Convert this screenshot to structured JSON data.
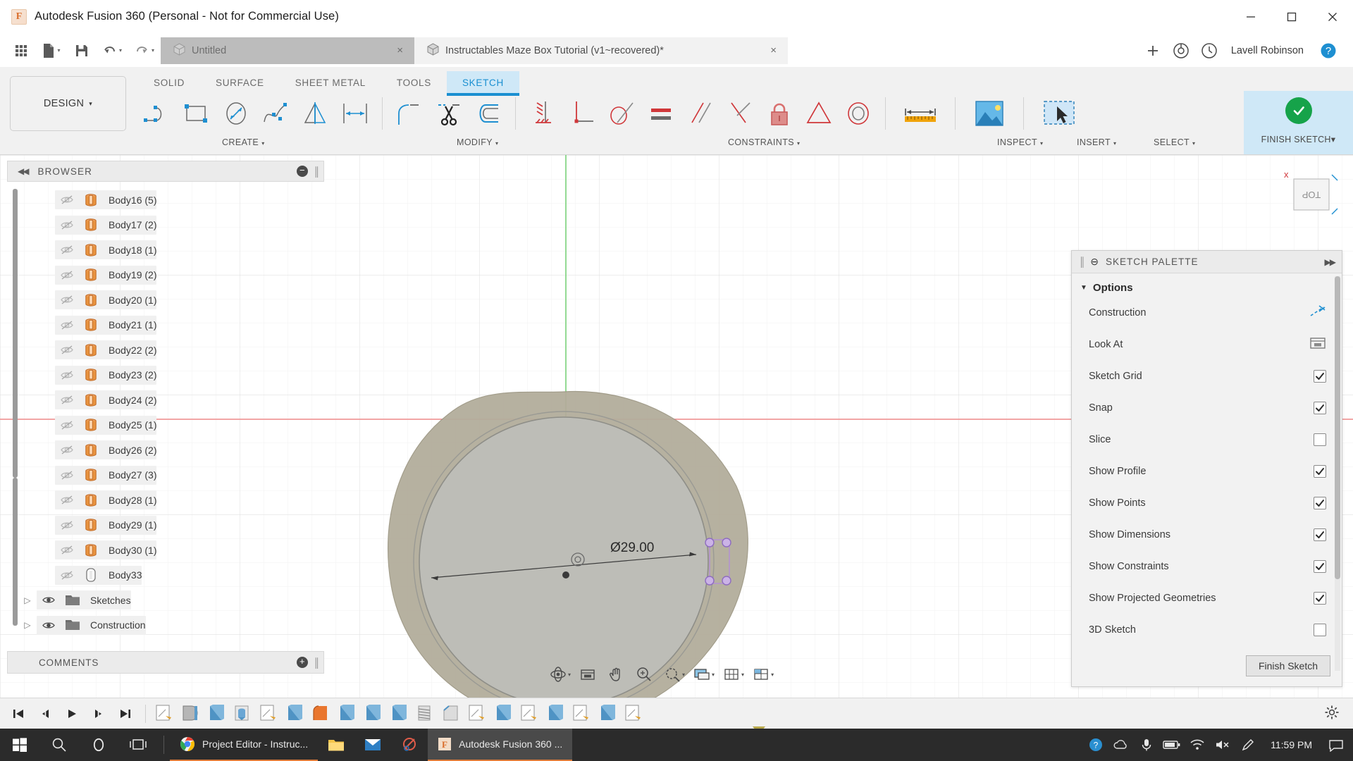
{
  "window": {
    "title": "Autodesk Fusion 360 (Personal - Not for Commercial Use)",
    "logo_letter": "F",
    "minimize": "minimize-icon",
    "maximize": "maximize-icon",
    "close": "close-icon"
  },
  "quickaccess": {
    "grid_label": "show-data-panel-icon",
    "new_label": "new-file-icon",
    "save_label": "save-icon",
    "undo_label": "undo-icon",
    "redo_label": "redo-icon",
    "user_name": "Lavell Robinson",
    "help_label": "help-icon",
    "job_label": "job-status-icon",
    "extensions_label": "extensions-icon",
    "add_tab_label": "+"
  },
  "tabs": [
    {
      "label": "Untitled",
      "active": false,
      "close": "×"
    },
    {
      "label": "Instructables Maze Box Tutorial (v1~recovered)*",
      "active": true,
      "close": "×"
    }
  ],
  "ribbon": {
    "design_label": "DESIGN",
    "design_caret": "▾",
    "workspace_tabs": [
      {
        "label": "SOLID",
        "active": false
      },
      {
        "label": "SURFACE",
        "active": false
      },
      {
        "label": "SHEET METAL",
        "active": false
      },
      {
        "label": "TOOLS",
        "active": false
      },
      {
        "label": "SKETCH",
        "active": true
      }
    ],
    "groups": [
      {
        "label": "CREATE",
        "caret": "▾"
      },
      {
        "label": "MODIFY",
        "caret": "▾"
      },
      {
        "label": "CONSTRAINTS",
        "caret": "▾"
      },
      {
        "label": "INSPECT",
        "caret": "▾"
      },
      {
        "label": "INSERT",
        "caret": "▾"
      },
      {
        "label": "SELECT",
        "caret": "▾"
      },
      {
        "label": "FINISH SKETCH",
        "caret": "▾"
      }
    ],
    "create_tools": [
      "line-icon",
      "rectangle-icon",
      "circle-icon",
      "spline-icon",
      "mirror-icon",
      "rectangular-pattern-icon"
    ],
    "modify_tools": [
      "fillet-icon",
      "trim-icon",
      "offset-icon"
    ],
    "constraint_tools": [
      "coincident-icon",
      "perpendicular-icon",
      "tangent-icon",
      "equal-icon",
      "parallel-icon",
      "midpoint-icon",
      "fix-lock-icon",
      "symmetry-icon",
      "concentric-icon"
    ],
    "inspect_tool": "measure-ruler-icon",
    "insert_tool": "insert-image-icon",
    "select_tool": "select-cursor-icon",
    "finish_tool": "finish-sketch-check-icon"
  },
  "browser": {
    "title": "BROWSER",
    "collapse_icon": "collapse-left-icon",
    "minus_icon": "−",
    "grip_icon": "panel-grip-icon",
    "comments_title": "COMMENTS",
    "comments_plus": "+",
    "items": [
      {
        "label": "Body16 (5)",
        "icon": "body-icon",
        "eye": "hidden-eye-icon",
        "twist": ""
      },
      {
        "label": "Body17 (2)",
        "icon": "body-icon",
        "eye": "hidden-eye-icon",
        "twist": ""
      },
      {
        "label": "Body18 (1)",
        "icon": "body-icon",
        "eye": "hidden-eye-icon",
        "twist": ""
      },
      {
        "label": "Body19 (2)",
        "icon": "body-icon",
        "eye": "hidden-eye-icon",
        "twist": ""
      },
      {
        "label": "Body20 (1)",
        "icon": "body-icon",
        "eye": "hidden-eye-icon",
        "twist": ""
      },
      {
        "label": "Body21 (1)",
        "icon": "body-icon",
        "eye": "hidden-eye-icon",
        "twist": ""
      },
      {
        "label": "Body22 (2)",
        "icon": "body-icon",
        "eye": "hidden-eye-icon",
        "twist": ""
      },
      {
        "label": "Body23 (2)",
        "icon": "body-icon",
        "eye": "hidden-eye-icon",
        "twist": ""
      },
      {
        "label": "Body24 (2)",
        "icon": "body-icon",
        "eye": "hidden-eye-icon",
        "twist": ""
      },
      {
        "label": "Body25 (1)",
        "icon": "body-icon",
        "eye": "hidden-eye-icon",
        "twist": ""
      },
      {
        "label": "Body26 (2)",
        "icon": "body-icon",
        "eye": "hidden-eye-icon",
        "twist": ""
      },
      {
        "label": "Body27 (3)",
        "icon": "body-icon",
        "eye": "hidden-eye-icon",
        "twist": ""
      },
      {
        "label": "Body28 (1)",
        "icon": "body-icon",
        "eye": "hidden-eye-icon",
        "twist": ""
      },
      {
        "label": "Body29 (1)",
        "icon": "body-icon",
        "eye": "hidden-eye-icon",
        "twist": ""
      },
      {
        "label": "Body30 (1)",
        "icon": "body-icon",
        "eye": "hidden-eye-icon",
        "twist": ""
      },
      {
        "label": "Body33",
        "icon": "sketch-body-icon",
        "eye": "hidden-eye-icon",
        "twist": ""
      },
      {
        "label": "Sketches",
        "icon": "folder-icon",
        "eye": "visible-eye-icon",
        "twist": "▷"
      },
      {
        "label": "Construction",
        "icon": "folder-icon",
        "eye": "visible-eye-icon",
        "twist": "▷"
      }
    ]
  },
  "palette": {
    "title": "SKETCH PALETTE",
    "minus_icon": "⊖",
    "expand_icon": "▶▶",
    "grip_icon": "panel-grip-icon",
    "section_title": "Options",
    "section_caret": "▼",
    "finish_button": "Finish Sketch",
    "rows": [
      {
        "label": "Construction",
        "control": "icon",
        "icon": "construction-line-icon",
        "checked": null
      },
      {
        "label": "Look At",
        "control": "icon",
        "icon": "look-at-icon",
        "checked": null
      },
      {
        "label": "Sketch Grid",
        "control": "checkbox",
        "icon": null,
        "checked": true
      },
      {
        "label": "Snap",
        "control": "checkbox",
        "icon": null,
        "checked": true
      },
      {
        "label": "Slice",
        "control": "checkbox",
        "icon": null,
        "checked": false
      },
      {
        "label": "Show Profile",
        "control": "checkbox",
        "icon": null,
        "checked": true
      },
      {
        "label": "Show Points",
        "control": "checkbox",
        "icon": null,
        "checked": true
      },
      {
        "label": "Show Dimensions",
        "control": "checkbox",
        "icon": null,
        "checked": true
      },
      {
        "label": "Show Constraints",
        "control": "checkbox",
        "icon": null,
        "checked": true
      },
      {
        "label": "Show Projected Geometries",
        "control": "checkbox",
        "icon": null,
        "checked": true
      },
      {
        "label": "3D Sketch",
        "control": "checkbox",
        "icon": null,
        "checked": false
      }
    ]
  },
  "canvas": {
    "dimension_label": "Ø29.00",
    "view_cube_label": "TOP",
    "axis_x_label": "x",
    "origin_label": "origin-point"
  },
  "navbar": {
    "items": [
      "orbit-icon",
      "look-at-icon",
      "pan-icon",
      "zoom-icon",
      "fit-icon",
      "display-settings-icon",
      "grid-snap-icon",
      "viewports-icon"
    ]
  },
  "timeline": {
    "buttons": [
      "go-to-beginning-icon",
      "step-back-icon",
      "play-icon",
      "step-forward-icon",
      "go-to-end-icon"
    ],
    "settings_icon": "timeline-settings-icon",
    "features": [
      "sketch-feature",
      "revolve-feature",
      "extrude-feature",
      "hole-feature",
      "sketch-feature",
      "extrude-feature",
      "fillet-feature",
      "extrude-feature",
      "extrude-feature",
      "extrude-feature",
      "thread-feature",
      "chamfer-feature",
      "sketch-feature",
      "extrude-feature",
      "sketch-feature",
      "extrude-feature",
      "sketch-feature",
      "extrude-feature",
      "sketch-feature"
    ]
  },
  "taskbar": {
    "start": "windows-start-icon",
    "search": "search-icon",
    "cortana": "cortana-icon",
    "taskview": "task-view-icon",
    "apps": [
      {
        "label": "Project Editor - Instruc...",
        "icon": "chrome-icon",
        "active": false,
        "underlined": true
      },
      {
        "label": "",
        "icon": "file-explorer-icon",
        "active": false,
        "underlined": false
      },
      {
        "label": "",
        "icon": "mail-icon",
        "active": false,
        "underlined": false
      },
      {
        "label": "",
        "icon": "snip-tool-icon",
        "active": false,
        "underlined": false
      },
      {
        "label": "Autodesk Fusion 360 ...",
        "icon": "fusion-icon",
        "active": true,
        "underlined": true
      }
    ],
    "tray": [
      "help-circle-icon",
      "cloud-icon",
      "microphone-icon",
      "battery-icon",
      "wifi-icon",
      "volume-mute-icon",
      "pen-icon"
    ],
    "clock": "11:59 PM",
    "notifications": "notification-icon"
  }
}
